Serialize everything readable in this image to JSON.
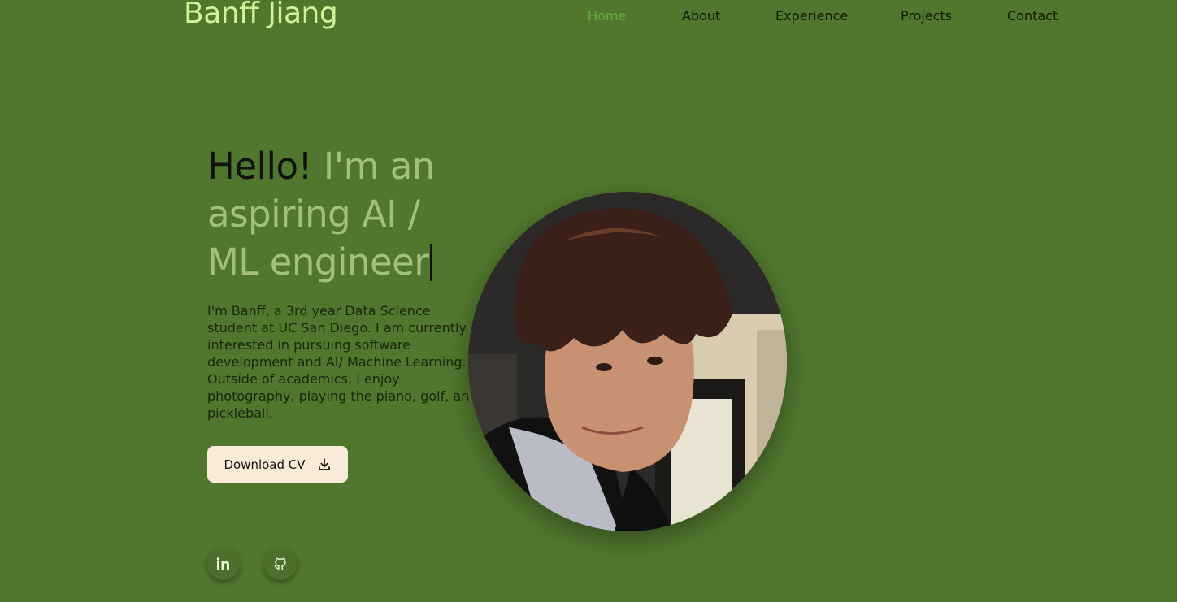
{
  "header": {
    "brand": "Banff Jiang",
    "nav": [
      {
        "label": "Home",
        "active": true
      },
      {
        "label": "About",
        "active": false
      },
      {
        "label": "Experience",
        "active": false
      },
      {
        "label": "Projects",
        "active": false
      },
      {
        "label": "Contact",
        "active": false
      }
    ]
  },
  "hero": {
    "greeting": "Hello!",
    "tagline_line1": "I'm an",
    "tagline_line2": "aspiring AI /",
    "tagline_line3": "ML engineer",
    "bio_lines": [
      "I'm Banff, a 3rd year Data Science",
      "student at UC San Diego. I am currently",
      "interested in pursuing software",
      "development and AI/ Machine Learning.",
      "Outside of academics, I enjoy",
      "photography, playing the piano, golf, and",
      "pickleball."
    ],
    "cv_button": "Download CV"
  },
  "social": {
    "linkedin_icon": "linkedin-icon",
    "github_icon": "github-icon"
  },
  "colors": {
    "background": "#51772e",
    "brand": "#d2f29a",
    "nav_active": "#5fb042",
    "accent_text": "#a3c07a",
    "button_bg": "#faebd9"
  }
}
